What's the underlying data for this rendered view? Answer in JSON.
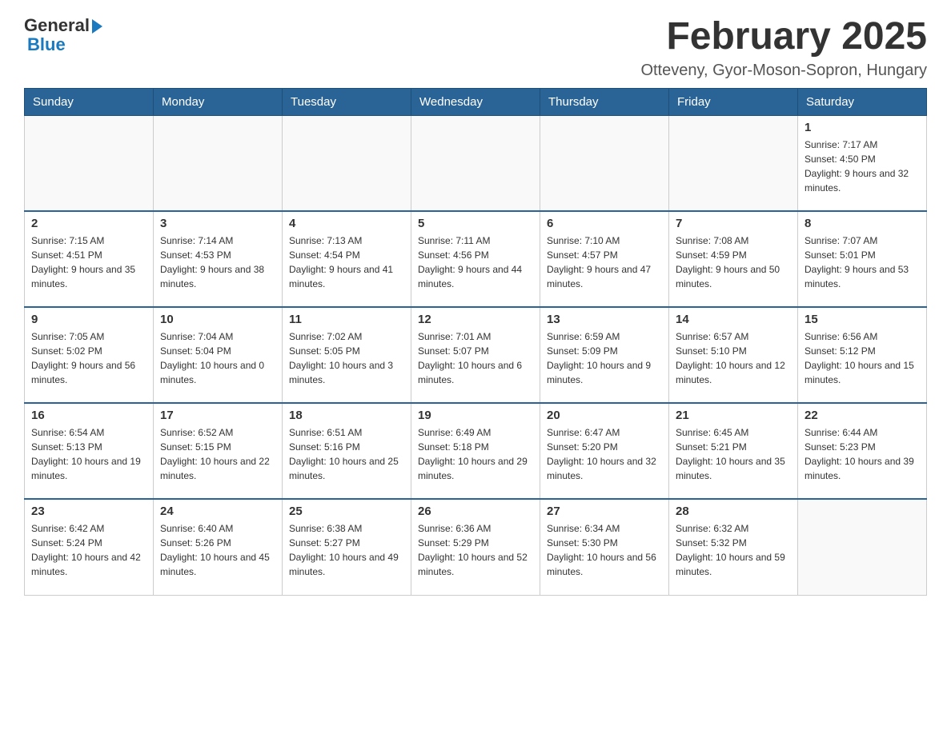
{
  "header": {
    "logo": {
      "general": "General",
      "blue": "Blue"
    },
    "title": "February 2025",
    "location": "Otteveny, Gyor-Moson-Sopron, Hungary"
  },
  "days_of_week": [
    "Sunday",
    "Monday",
    "Tuesday",
    "Wednesday",
    "Thursday",
    "Friday",
    "Saturday"
  ],
  "weeks": [
    [
      {
        "day": "",
        "info": ""
      },
      {
        "day": "",
        "info": ""
      },
      {
        "day": "",
        "info": ""
      },
      {
        "day": "",
        "info": ""
      },
      {
        "day": "",
        "info": ""
      },
      {
        "day": "",
        "info": ""
      },
      {
        "day": "1",
        "info": "Sunrise: 7:17 AM\nSunset: 4:50 PM\nDaylight: 9 hours and 32 minutes."
      }
    ],
    [
      {
        "day": "2",
        "info": "Sunrise: 7:15 AM\nSunset: 4:51 PM\nDaylight: 9 hours and 35 minutes."
      },
      {
        "day": "3",
        "info": "Sunrise: 7:14 AM\nSunset: 4:53 PM\nDaylight: 9 hours and 38 minutes."
      },
      {
        "day": "4",
        "info": "Sunrise: 7:13 AM\nSunset: 4:54 PM\nDaylight: 9 hours and 41 minutes."
      },
      {
        "day": "5",
        "info": "Sunrise: 7:11 AM\nSunset: 4:56 PM\nDaylight: 9 hours and 44 minutes."
      },
      {
        "day": "6",
        "info": "Sunrise: 7:10 AM\nSunset: 4:57 PM\nDaylight: 9 hours and 47 minutes."
      },
      {
        "day": "7",
        "info": "Sunrise: 7:08 AM\nSunset: 4:59 PM\nDaylight: 9 hours and 50 minutes."
      },
      {
        "day": "8",
        "info": "Sunrise: 7:07 AM\nSunset: 5:01 PM\nDaylight: 9 hours and 53 minutes."
      }
    ],
    [
      {
        "day": "9",
        "info": "Sunrise: 7:05 AM\nSunset: 5:02 PM\nDaylight: 9 hours and 56 minutes."
      },
      {
        "day": "10",
        "info": "Sunrise: 7:04 AM\nSunset: 5:04 PM\nDaylight: 10 hours and 0 minutes."
      },
      {
        "day": "11",
        "info": "Sunrise: 7:02 AM\nSunset: 5:05 PM\nDaylight: 10 hours and 3 minutes."
      },
      {
        "day": "12",
        "info": "Sunrise: 7:01 AM\nSunset: 5:07 PM\nDaylight: 10 hours and 6 minutes."
      },
      {
        "day": "13",
        "info": "Sunrise: 6:59 AM\nSunset: 5:09 PM\nDaylight: 10 hours and 9 minutes."
      },
      {
        "day": "14",
        "info": "Sunrise: 6:57 AM\nSunset: 5:10 PM\nDaylight: 10 hours and 12 minutes."
      },
      {
        "day": "15",
        "info": "Sunrise: 6:56 AM\nSunset: 5:12 PM\nDaylight: 10 hours and 15 minutes."
      }
    ],
    [
      {
        "day": "16",
        "info": "Sunrise: 6:54 AM\nSunset: 5:13 PM\nDaylight: 10 hours and 19 minutes."
      },
      {
        "day": "17",
        "info": "Sunrise: 6:52 AM\nSunset: 5:15 PM\nDaylight: 10 hours and 22 minutes."
      },
      {
        "day": "18",
        "info": "Sunrise: 6:51 AM\nSunset: 5:16 PM\nDaylight: 10 hours and 25 minutes."
      },
      {
        "day": "19",
        "info": "Sunrise: 6:49 AM\nSunset: 5:18 PM\nDaylight: 10 hours and 29 minutes."
      },
      {
        "day": "20",
        "info": "Sunrise: 6:47 AM\nSunset: 5:20 PM\nDaylight: 10 hours and 32 minutes."
      },
      {
        "day": "21",
        "info": "Sunrise: 6:45 AM\nSunset: 5:21 PM\nDaylight: 10 hours and 35 minutes."
      },
      {
        "day": "22",
        "info": "Sunrise: 6:44 AM\nSunset: 5:23 PM\nDaylight: 10 hours and 39 minutes."
      }
    ],
    [
      {
        "day": "23",
        "info": "Sunrise: 6:42 AM\nSunset: 5:24 PM\nDaylight: 10 hours and 42 minutes."
      },
      {
        "day": "24",
        "info": "Sunrise: 6:40 AM\nSunset: 5:26 PM\nDaylight: 10 hours and 45 minutes."
      },
      {
        "day": "25",
        "info": "Sunrise: 6:38 AM\nSunset: 5:27 PM\nDaylight: 10 hours and 49 minutes."
      },
      {
        "day": "26",
        "info": "Sunrise: 6:36 AM\nSunset: 5:29 PM\nDaylight: 10 hours and 52 minutes."
      },
      {
        "day": "27",
        "info": "Sunrise: 6:34 AM\nSunset: 5:30 PM\nDaylight: 10 hours and 56 minutes."
      },
      {
        "day": "28",
        "info": "Sunrise: 6:32 AM\nSunset: 5:32 PM\nDaylight: 10 hours and 59 minutes."
      },
      {
        "day": "",
        "info": ""
      }
    ]
  ]
}
